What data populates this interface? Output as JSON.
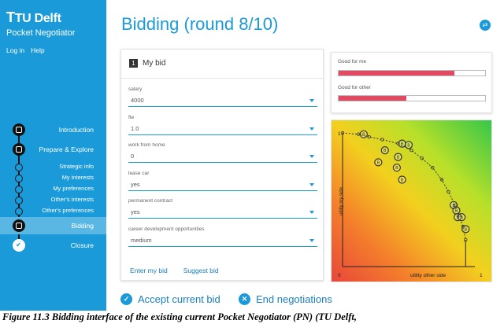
{
  "sidebar": {
    "logo": "TU Delft",
    "app_name": "Pocket Negotiator",
    "login": "Log in",
    "help": "Help",
    "steps": [
      {
        "label": "Introduction",
        "kind": "big"
      },
      {
        "label": "Prepare & Explore",
        "kind": "big"
      },
      {
        "label": "Strategic info",
        "kind": "small"
      },
      {
        "label": "My interests",
        "kind": "small"
      },
      {
        "label": "My preferences",
        "kind": "small"
      },
      {
        "label": "Other's interests",
        "kind": "small"
      },
      {
        "label": "Other's preferences",
        "kind": "small"
      },
      {
        "label": "Bidding",
        "kind": "active"
      },
      {
        "label": "Closure",
        "kind": "closure"
      }
    ]
  },
  "header": {
    "title": "Bidding (round 8/10)",
    "icon": "swap-icon"
  },
  "bid": {
    "number": "1",
    "title": "My bid",
    "fields": [
      {
        "label": "salary",
        "value": "4000"
      },
      {
        "label": "fte",
        "value": "1.0"
      },
      {
        "label": "work from home",
        "value": "0"
      },
      {
        "label": "lease car",
        "value": "yes"
      },
      {
        "label": "permanent contract",
        "value": "yes"
      },
      {
        "label": "career development opportunities",
        "value": "medium"
      }
    ],
    "enter_label": "Enter my bid",
    "suggest_label": "Suggest bid"
  },
  "utility": {
    "good_for_me_label": "Good for me",
    "good_for_me_value": 0.79,
    "good_for_other_label": "Good for other",
    "good_for_other_value": 0.46,
    "bar_color": "#e04a63"
  },
  "chart_data": {
    "type": "scatter",
    "xlabel": "utility other side",
    "ylabel": "utility my side",
    "xlim": [
      0,
      1
    ],
    "ylim": [
      0,
      1
    ],
    "x_ticks": [
      "0",
      "1"
    ],
    "y_ticks": [
      "1"
    ],
    "frontier": [
      {
        "x": 0.0,
        "y": 1.0
      },
      {
        "x": 0.12,
        "y": 0.99
      },
      {
        "x": 0.2,
        "y": 0.97
      },
      {
        "x": 0.3,
        "y": 0.95
      },
      {
        "x": 0.42,
        "y": 0.92
      },
      {
        "x": 0.52,
        "y": 0.87
      },
      {
        "x": 0.6,
        "y": 0.81
      },
      {
        "x": 0.68,
        "y": 0.74
      },
      {
        "x": 0.75,
        "y": 0.65
      },
      {
        "x": 0.8,
        "y": 0.56
      },
      {
        "x": 0.85,
        "y": 0.46
      },
      {
        "x": 0.88,
        "y": 0.38
      },
      {
        "x": 0.91,
        "y": 0.3
      },
      {
        "x": 0.93,
        "y": 0.2
      }
    ],
    "bids": [
      {
        "x": 0.16,
        "y": 0.99,
        "label": "B"
      },
      {
        "x": 0.45,
        "y": 0.92,
        "label": "B"
      },
      {
        "x": 0.5,
        "y": 0.91,
        "label": "B"
      },
      {
        "x": 0.32,
        "y": 0.87,
        "label": "B"
      },
      {
        "x": 0.42,
        "y": 0.82,
        "label": "B"
      },
      {
        "x": 0.27,
        "y": 0.78,
        "label": "B"
      },
      {
        "x": 0.41,
        "y": 0.74,
        "label": "B"
      },
      {
        "x": 0.45,
        "y": 0.65,
        "label": "B"
      },
      {
        "x": 0.84,
        "y": 0.46,
        "label": "B"
      },
      {
        "x": 0.86,
        "y": 0.42,
        "label": "B"
      },
      {
        "x": 0.87,
        "y": 0.37,
        "label": "B"
      },
      {
        "x": 0.9,
        "y": 0.37,
        "label": "B"
      },
      {
        "x": 0.93,
        "y": 0.28,
        "label": "B"
      }
    ],
    "marker_color": "#333333"
  },
  "actions": {
    "accept_label": "Accept current bid",
    "end_label": "End negotiations"
  },
  "caption": "Figure 11.3 Bidding interface of the existing current Pocket Negotiator (PN) (TU Delft,"
}
